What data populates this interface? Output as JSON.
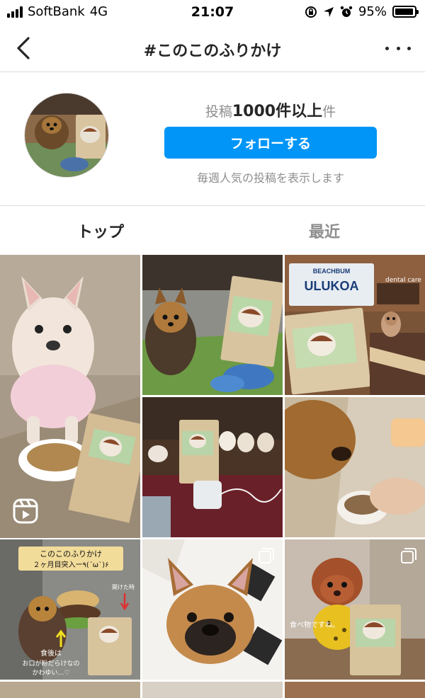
{
  "status_bar": {
    "carrier": "SoftBank",
    "network": "4G",
    "time": "21:07",
    "battery": "95%",
    "battery_level": 0.95
  },
  "nav": {
    "title": "#このこのふりかけ"
  },
  "header": {
    "post_prefix": "投稿",
    "post_count": "1000件以上",
    "post_suffix": "件",
    "follow_label": "フォローする",
    "note": "毎週人気の投稿を表示します"
  },
  "tabs": [
    {
      "label": "トップ",
      "active": true
    },
    {
      "label": "最近",
      "active": false
    }
  ],
  "posts": [
    {
      "subject": "french-bulldog-with-food-bowl",
      "type": "reel"
    },
    {
      "subject": "yorkie-with-furikake-bag",
      "type": "photo"
    },
    {
      "subject": "italian-greyhound-beach-sign",
      "type": "photo"
    },
    {
      "subject": "furikake-bag-with-puppies",
      "type": "photo"
    },
    {
      "subject": "dog-eating-from-bowl",
      "type": "photo"
    },
    {
      "subject": "yorkie-furikake-two-months",
      "type": "photo"
    },
    {
      "subject": "french-bulldog-closeup",
      "type": "carousel"
    },
    {
      "subject": "toy-poodle-with-bag",
      "type": "carousel"
    }
  ],
  "overlay_text": {
    "post6_line1": "このこのふりかけ",
    "post6_line2": "２ヶ月目突入ー٩(ˊωˋ)۶",
    "post6_note": "開けた時",
    "post6_caption1": "食後は",
    "post6_caption2": "お口が粉だらけなの",
    "post6_caption3": "かわゆい…♡",
    "post3_sign1": "BEACHBUM",
    "post3_sign2": "ULUKOA",
    "post3_sign3": "dental care",
    "post8_caption": "食べ物ですね。"
  },
  "colors": {
    "accent": "#0095f6",
    "muted": "#8e8e8e",
    "text": "#262626",
    "divider": "#dbdbdb"
  }
}
